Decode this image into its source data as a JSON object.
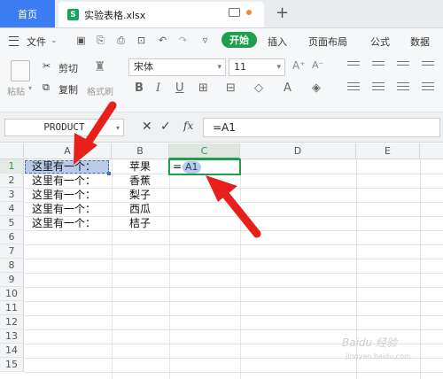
{
  "tabs": {
    "home": "首页",
    "document": "实验表格.xlsx",
    "doc_icon_letter": "S"
  },
  "menu": {
    "file": "文件",
    "start": "开始",
    "insert": "插入",
    "page_layout": "页面布局",
    "formula": "公式",
    "data": "数据"
  },
  "ribbon": {
    "cut": "剪切",
    "copy": "复制",
    "paste": "粘贴",
    "format_painter": "格式刷",
    "font_name": "宋体",
    "font_size": "11"
  },
  "formula_bar": {
    "name_box": "PRODUCT",
    "fx": "fx",
    "content": "=A1"
  },
  "columns": [
    "A",
    "B",
    "C",
    "D",
    "E"
  ],
  "rows": [
    "1",
    "2",
    "3",
    "4",
    "5",
    "6",
    "7",
    "8",
    "9",
    "10",
    "11",
    "12",
    "13",
    "14",
    "15"
  ],
  "cells": {
    "A": [
      "这里有一个：",
      "这里有一个：",
      "这里有一个：",
      "这里有一个：",
      "这里有一个："
    ],
    "B": [
      "苹果",
      "香蕉",
      "梨子",
      "西瓜",
      "桔子"
    ],
    "C1_eq": "=",
    "C1_ref": "A1"
  },
  "watermark": {
    "text": "Baidu 经验",
    "url": "jingyan.baidu.com"
  },
  "colors": {
    "accent_green": "#1e9e4f",
    "tab_blue": "#3d7df3",
    "arrow_red": "#e8201c",
    "ref_highlight": "#b9cbe6"
  }
}
